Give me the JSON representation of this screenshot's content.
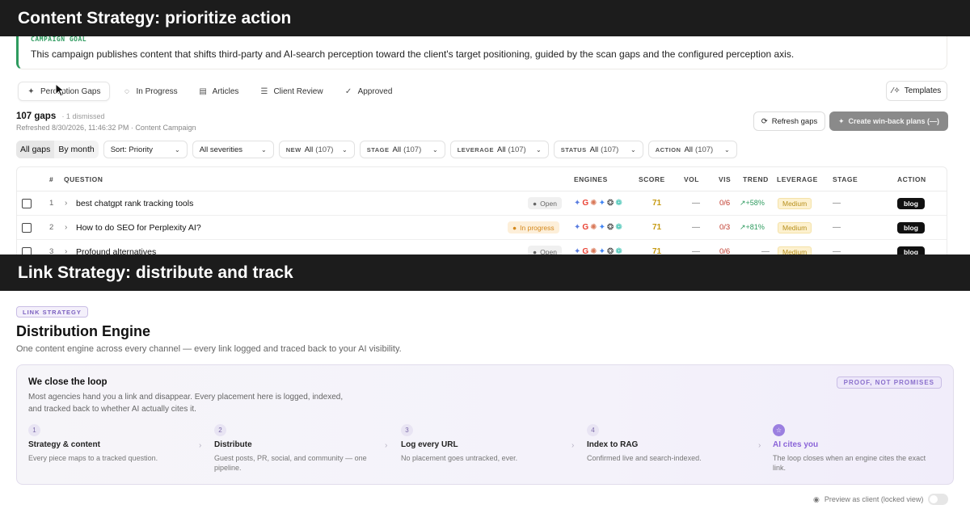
{
  "sections": {
    "top": "Content Strategy: prioritize action",
    "bottom": "Link Strategy: distribute and track"
  },
  "campaign_goal": {
    "label": "CAMPAIGN GOAL",
    "text": "This campaign publishes content that shifts third-party and AI-search perception toward the client's target positioning, guided by the scan gaps and the configured perception axis."
  },
  "tabs": [
    {
      "label": "Perception Gaps",
      "icon": "sparkle-icon"
    },
    {
      "label": "In Progress",
      "icon": "progress-icon"
    },
    {
      "label": "Articles",
      "icon": "document-icon"
    },
    {
      "label": "Client Review",
      "icon": "list-icon"
    },
    {
      "label": "Approved",
      "icon": "check-icon"
    }
  ],
  "templates_label": "Templates",
  "summary": {
    "gaps": "107 gaps",
    "dismissed": "· 1 dismissed",
    "refreshed": "Refreshed 8/30/2026, 11:46:32 PM · Content Campaign"
  },
  "buttons": {
    "refresh": "Refresh gaps",
    "winback": "Create win-back plans (—)"
  },
  "filters": {
    "view": [
      "All gaps",
      "By month"
    ],
    "sort": "Sort: Priority",
    "severity": "All severities",
    "dropdowns": [
      {
        "key": "NEW",
        "value": "All",
        "count": "(107)"
      },
      {
        "key": "STAGE",
        "value": "All",
        "count": "(107)"
      },
      {
        "key": "LEVERAGE",
        "value": "All",
        "count": "(107)"
      },
      {
        "key": "STATUS",
        "value": "All",
        "count": "(107)"
      },
      {
        "key": "ACTION",
        "value": "All",
        "count": "(107)"
      }
    ]
  },
  "table": {
    "headers": [
      "#",
      "QUESTION",
      "ENGINES",
      "SCORE",
      "VOL",
      "VIS",
      "TREND",
      "LEVERAGE",
      "STAGE",
      "ACTION"
    ],
    "rows": [
      {
        "num": "1",
        "question": "best chatgpt rank tracking tools",
        "status": "Open",
        "score": "71",
        "vol": "—",
        "vis": "0/6",
        "trend": "+58%",
        "leverage": "Medium",
        "stage": "—",
        "action": "blog"
      },
      {
        "num": "2",
        "question": "How to do SEO for Perplexity AI?",
        "status": "In progress",
        "score": "71",
        "vol": "—",
        "vis": "0/3",
        "trend": "+81%",
        "leverage": "Medium",
        "stage": "—",
        "action": "blog"
      },
      {
        "num": "3",
        "question": "Profound alternatives",
        "status": "Open",
        "score": "71",
        "vol": "—",
        "vis": "0/6",
        "trend": "—",
        "leverage": "Medium",
        "stage": "—",
        "action": "blog"
      }
    ]
  },
  "link_strategy": {
    "badge": "LINK STRATEGY",
    "title": "Distribution Engine",
    "subtitle": "One content engine across every channel — every link logged and traced back to your AI visibility.",
    "loop": {
      "title": "We close the loop",
      "desc_line1": "Most agencies hand you a link and disappear. Every placement here is logged, indexed,",
      "desc_line2": "and tracked back to whether AI actually cites it.",
      "badge": "PROOF, NOT PROMISES",
      "steps": [
        {
          "num": "1",
          "title": "Strategy & content",
          "desc": "Every piece maps to a tracked question."
        },
        {
          "num": "2",
          "title": "Distribute",
          "desc": "Guest posts, PR, social, and community — one pipeline."
        },
        {
          "num": "3",
          "title": "Log every URL",
          "desc": "No placement goes untracked, ever."
        },
        {
          "num": "4",
          "title": "Index to RAG",
          "desc": "Confirmed live and search-indexed."
        },
        {
          "num": "☆",
          "title": "AI cites you",
          "desc": "The loop closes when an engine cites the exact link."
        }
      ]
    },
    "preview": "Preview as client (locked view)"
  },
  "colors": {
    "goal_accent": "#2e9b5f",
    "score": "#c69a12",
    "vis": "#c0392b",
    "trend": "#2e9b5f",
    "leverage_bg": "#fdf1cf",
    "purple_accent": "#8a64d8"
  }
}
